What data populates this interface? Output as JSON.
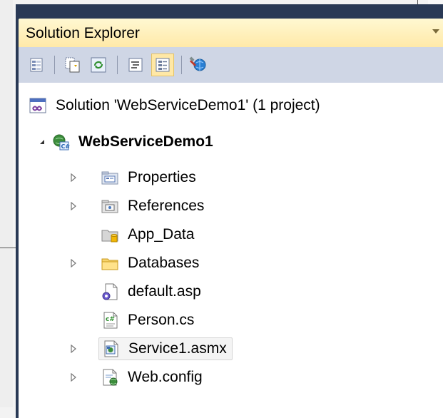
{
  "panel": {
    "title": "Solution Explorer"
  },
  "toolbar": {
    "buttons": [
      {
        "icon": "properties-icon"
      },
      {
        "icon": "show-all-files-icon"
      },
      {
        "icon": "refresh-icon"
      },
      {
        "icon": "view-code-icon"
      },
      {
        "icon": "view-designer-icon",
        "active": true
      },
      {
        "icon": "copy-website-icon"
      }
    ]
  },
  "tree": {
    "solution": "Solution 'WebServiceDemo1' (1 project)",
    "project": "WebServiceDemo1",
    "items": [
      {
        "label": "Properties",
        "icon": "properties-folder-icon",
        "expandable": true
      },
      {
        "label": "References",
        "icon": "references-icon",
        "expandable": true
      },
      {
        "label": "App_Data",
        "icon": "app-data-folder-icon",
        "expandable": false
      },
      {
        "label": "Databases",
        "icon": "folder-icon",
        "expandable": true
      },
      {
        "label": "default.asp",
        "icon": "asp-file-icon",
        "expandable": false
      },
      {
        "label": "Person.cs",
        "icon": "csharp-file-icon",
        "expandable": false
      },
      {
        "label": "Service1.asmx",
        "icon": "asmx-file-icon",
        "expandable": true,
        "selected": true
      },
      {
        "label": "Web.config",
        "icon": "config-file-icon",
        "expandable": true
      }
    ]
  },
  "colors": {
    "frame": "#293955",
    "title_gradient_top": "#fff8d2",
    "title_gradient_bottom": "#ffe9a8",
    "toolbar": "#cfd6e5",
    "active_button": "#ffe8a6"
  }
}
